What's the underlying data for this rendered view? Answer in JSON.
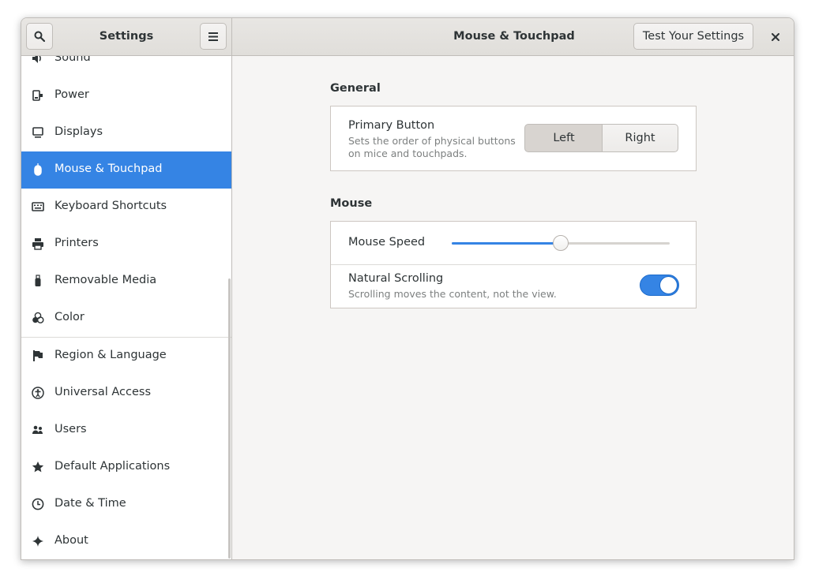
{
  "window": {
    "sidebar_title": "Settings",
    "panel_title": "Mouse & Touchpad",
    "test_button": "Test Your Settings"
  },
  "sidebar": {
    "items": [
      {
        "label": "Sound",
        "icon": "speaker-icon"
      },
      {
        "label": "Power",
        "icon": "power-plug-icon"
      },
      {
        "label": "Displays",
        "icon": "display-icon"
      },
      {
        "label": "Mouse & Touchpad",
        "icon": "mouse-icon",
        "selected": true
      },
      {
        "label": "Keyboard Shortcuts",
        "icon": "keyboard-icon"
      },
      {
        "label": "Printers",
        "icon": "printer-icon"
      },
      {
        "label": "Removable Media",
        "icon": "usb-drive-icon"
      },
      {
        "label": "Color",
        "icon": "color-circles-icon"
      },
      {
        "label": "Region & Language",
        "icon": "flag-icon"
      },
      {
        "label": "Universal Access",
        "icon": "accessibility-icon"
      },
      {
        "label": "Users",
        "icon": "users-icon"
      },
      {
        "label": "Default Applications",
        "icon": "star-icon"
      },
      {
        "label": "Date & Time",
        "icon": "clock-icon"
      },
      {
        "label": "About",
        "icon": "sparkle-icon"
      }
    ]
  },
  "general": {
    "title": "General",
    "primary_button": {
      "title": "Primary Button",
      "subtitle_line1": "Sets the order of physical buttons",
      "subtitle_line2": "on mice and touchpads.",
      "options": [
        "Left",
        "Right"
      ],
      "selected": "Left"
    }
  },
  "mouse": {
    "title": "Mouse",
    "speed": {
      "label": "Mouse Speed",
      "value_fraction": 0.5
    },
    "natural_scrolling": {
      "title": "Natural Scrolling",
      "subtitle": "Scrolling moves the content, not the view.",
      "enabled": true
    }
  },
  "colors": {
    "accent": "#3584e4",
    "window_bg": "#f6f5f4",
    "sidebar_bg": "#ffffff"
  }
}
